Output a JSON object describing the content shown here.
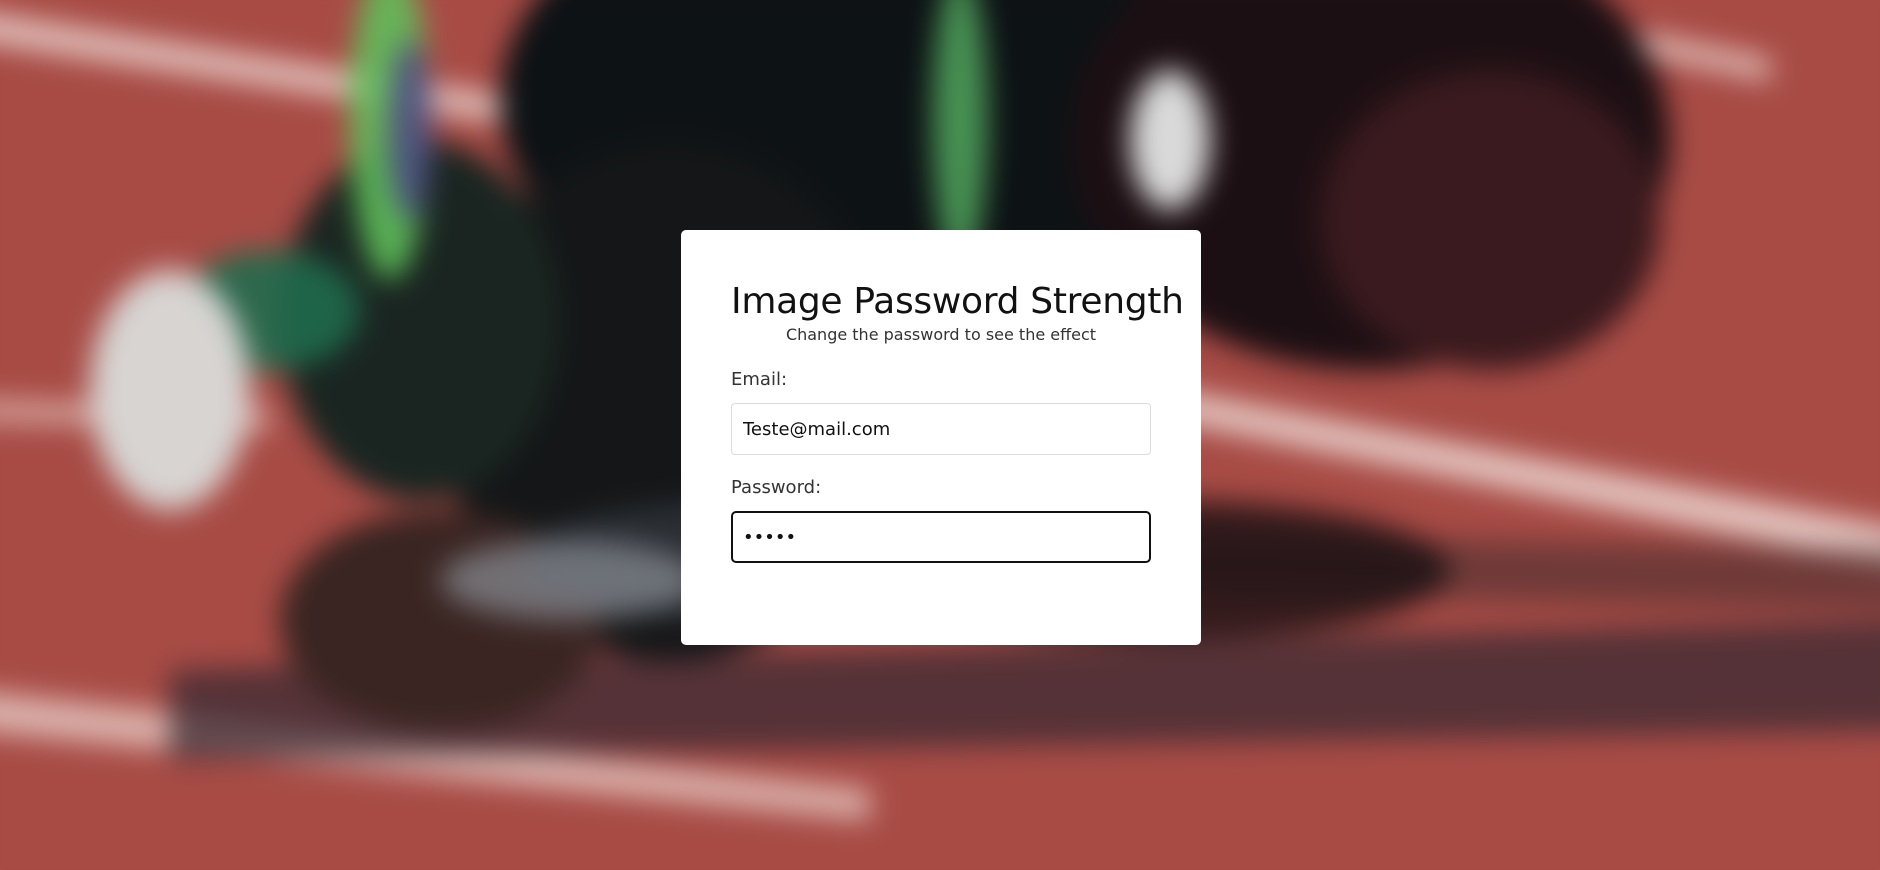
{
  "form": {
    "title": "Image Password Strength",
    "subtitle": "Change the password to see the effect",
    "email_label": "Email:",
    "email_value": "Teste@mail.com",
    "password_label": "Password:",
    "password_value": "•••••"
  },
  "theme": {
    "card_background": "#ffffff",
    "track_color": "#a64a44",
    "focus_border_color": "#111111"
  }
}
